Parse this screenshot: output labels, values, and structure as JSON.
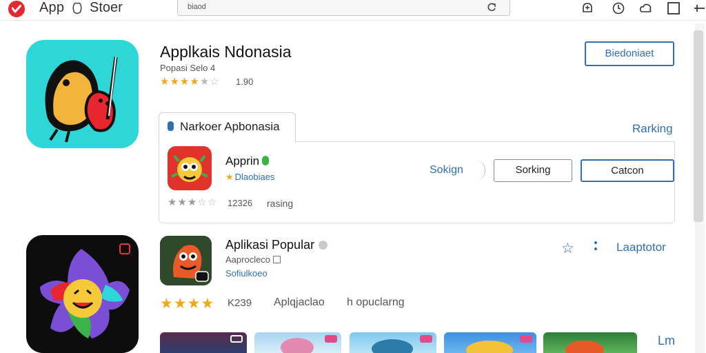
{
  "header": {
    "app_label": "App",
    "store_label": "Stoer",
    "url_text": "biaod",
    "icons": [
      "reload-icon",
      "bell-icon",
      "clock-icon",
      "cloud-icon",
      "window-icon",
      "menu-icon"
    ]
  },
  "hero": {
    "title": "Applkais Ndonasia",
    "subtitle": "Popasi Selo 4",
    "rating_stars": 4.5,
    "rating_count": "1.90",
    "primary_button": "Biedoniaet"
  },
  "featured_card": {
    "tab_label": "Narkoer Apbonasia",
    "ranking_link": "Rarking",
    "app": {
      "name": "Apprin",
      "subtitle": "Dlaobiaes",
      "rating_stars": 3,
      "rating_count": "12326",
      "rating_label": "rasing"
    },
    "sorting_link": "Sokign",
    "button_secondary": "Sorking",
    "button_primary": "Catcon"
  },
  "popular": {
    "title": "Aplikasi Popular",
    "subtitle": "Aaprocleco",
    "link_sub": "Sofiulkoeo",
    "rating_stars": 4,
    "rating_count": "K239",
    "category": "Aplqjaclao",
    "tag": "h opuclarng",
    "link": "Laaptotor",
    "more_label": "Lm"
  },
  "colors": {
    "accent": "#2f6fb3",
    "star": "#f0a81a",
    "brand": "#e8262f",
    "hero_icon_bg": "#2ed6d8"
  }
}
